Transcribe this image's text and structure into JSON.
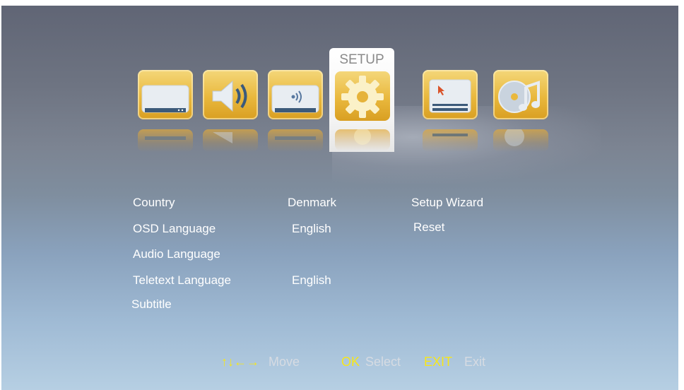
{
  "menu": {
    "active_tab_label": "SETUP",
    "icons": [
      "tv-picture-icon",
      "speaker-audio-icon",
      "signal-channel-icon",
      "gear-setup-icon",
      "screen-cursor-icon",
      "media-music-icon"
    ]
  },
  "settings": {
    "country_label": "Country",
    "country_value": "Denmark",
    "osd_language_label": "OSD Language",
    "osd_language_value": "English",
    "audio_language_label": "Audio Language",
    "teletext_language_label": "Teletext Language",
    "teletext_language_value": "English",
    "subtitle_label": "Subtitle",
    "setup_wizard_label": "Setup Wizard",
    "reset_label": "Reset"
  },
  "footer": {
    "move_arrows": "↑↓←→",
    "move_label": "Move",
    "ok_key": "OK",
    "select_label": "Select",
    "exit_key": "EXIT",
    "exit_label": "Exit"
  },
  "colors": {
    "accent_yellow": "#f7e61a",
    "icon_gold": "#e9b83d"
  }
}
